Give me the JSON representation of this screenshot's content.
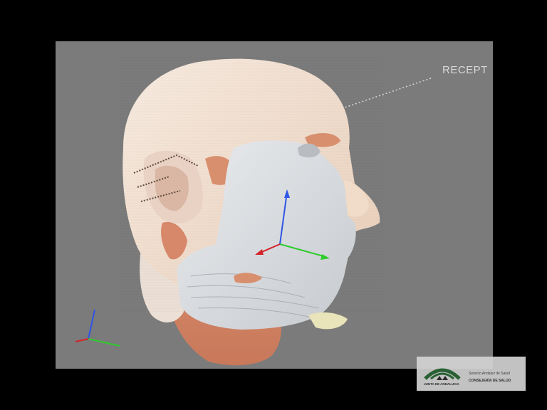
{
  "viewer": {
    "background_color": "#7b7b7b",
    "frame_color": "#000000",
    "annotation": {
      "label": "RECEPT",
      "color": "#d9d9d9"
    },
    "axes": {
      "x_color": "#2ecc2e",
      "y_color": "#2f55e6",
      "z_color": "#d4232b"
    },
    "model": {
      "skin_color": "#f3e3d6",
      "mask_color": "#dadde0",
      "tissue_color": "#d88f6e"
    }
  },
  "logo": {
    "institution": "JUNTA DE ANDALUCIA",
    "service": "Servicio Andaluz de Salud",
    "department": "CONSEJERÍA DE SALUD"
  }
}
